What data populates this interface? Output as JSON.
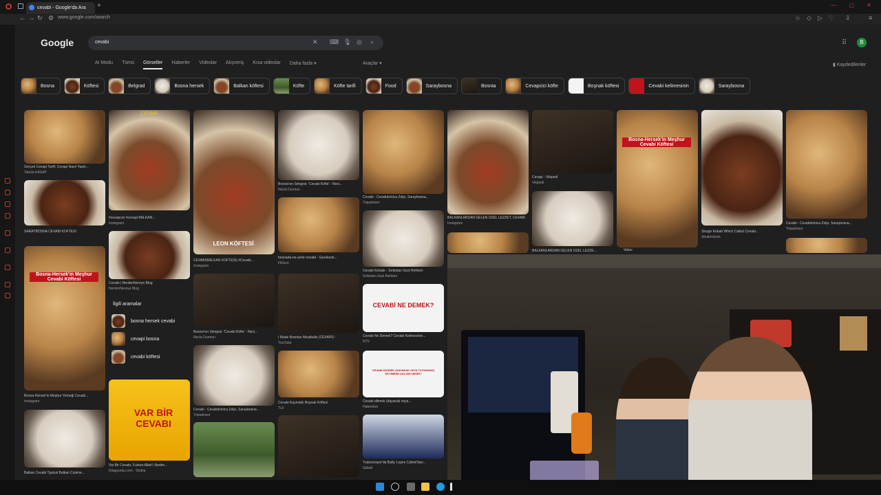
{
  "browser": {
    "tab_title": "cevabi - Google'da Ara",
    "new_tab": "+",
    "url": "www.google.com/search"
  },
  "google": {
    "logo": "Google",
    "query": "cevabi",
    "avatar_letter": "B",
    "nav_tabs": [
      "AI Modu",
      "Tümü",
      "Görseller",
      "Haberler",
      "Videolar",
      "Alışveriş",
      "Kısa videolar",
      "Daha fazla"
    ],
    "active_tab": "Görseller",
    "tools": "Araçlar",
    "saved": "Kaydedilenler"
  },
  "chips": [
    {
      "label": "Bosna"
    },
    {
      "label": "Köftesi"
    },
    {
      "label": "Belgrad"
    },
    {
      "label": "Bosna hersek"
    },
    {
      "label": "Balkan köftesi"
    },
    {
      "label": "Köfte"
    },
    {
      "label": "Köfte tarifi"
    },
    {
      "label": "Food"
    },
    {
      "label": "Saraybosna"
    },
    {
      "label": "Bosnia"
    },
    {
      "label": "Cevapcici köfte"
    },
    {
      "label": "Boşnak köftesi"
    },
    {
      "label": "Cevabi kelimesinin"
    },
    {
      "label": "Saraybosna"
    }
  ],
  "related": {
    "title": "İlgili aramalar",
    "items": [
      "bosna hersek cevabi",
      "cevapi bosna",
      "cevabi köftesi"
    ]
  },
  "results": [
    {
      "caption": "Gerçek Cevapi Tarifi: Cevapi Nasıl Yapılı...",
      "source": "Tabula KASAP"
    },
    {
      "caption": "#cevapcici #cevapi BALKAN...",
      "source": "Instagram"
    },
    {
      "caption": "CEVABİ(BALKAN KÖFTESİ) #Cevabi...",
      "source": "Instagram"
    },
    {
      "caption": "Bosna'nın Simgesi: 'Cevabi Köfte' - Necl...",
      "source": "Necla Durmun"
    },
    {
      "caption": "Cevabi - Cevabdzinica Zeljo, Saraybosna...",
      "source": "Tripadvisor"
    },
    {
      "caption": "BALKANLARDAN GELEN ÖZEL LEZZET, CEVABİ",
      "source": "Instagram"
    },
    {
      "caption": "Ćevapi - Vikipedi",
      "source": "Vikipedi"
    },
    {
      "caption": "Skopje Kebab Which Called Cevabi...",
      "source": "Shutterstock"
    },
    {
      "caption": "Cevabi - Cevabdzinica Zeljo, Saraybosna...",
      "source": "Tripadvisor"
    },
    {
      "caption": "SARAYBOSNA CEVABİ KÖFTESİ",
      "source": ""
    },
    {
      "caption": "Cevabi | NerdenNereye Blog",
      "source": "NerdenNereye Blog"
    },
    {
      "caption": "bosnada-ne-yenir-cevabi - Gezilecek...",
      "source": "FilGezi"
    },
    {
      "caption": "Cevabi Kebabı - Sırbistan Gezi Rehberi",
      "source": "Sırbistan Gezi Rehberi"
    },
    {
      "caption": "BALKANLARDAN GELEN ÖZEL LEZZE...",
      "source": ""
    },
    {
      "caption": "Bosna'nın Simgesi: 'Cevabi Köfte' - Necl...",
      "source": "Necla Durmun"
    },
    {
      "caption": "I Made Bosnian Meatballs (ĆEVAPI)! -",
      "source": "YouTube"
    },
    {
      "caption": "Cevabi Ne Demek? Cevabi Kelimesinin...",
      "source": "NTV"
    },
    {
      "caption": "Bosna-Hersek'in Meşhur Yemeği Cevabi...",
      "source": "Instagram"
    },
    {
      "caption": "Cevabi - Cevabdzinica Zeljo, Saraybosna...",
      "source": "Tripadvisor"
    },
    {
      "caption": "Cevabi Kaymaklı Boşnak Köftesi",
      "source": "Tv2"
    },
    {
      "caption": "Cevabi dilimek (dayanak veya...",
      "source": "Habertürk"
    },
    {
      "caption": "Balkan Cevabi Typical Balkan Cuisine...",
      "source": ""
    },
    {
      "caption": "Var Bir Cevabı, Furkan Allah'ı Neden...",
      "source": "Kitapyurdu.com · Stokta"
    },
    {
      "caption": "Trabzonspor'da Batty Lopes Cabrel'dan...",
      "source": "Sabah"
    }
  ],
  "overlay_text": {
    "bosna1": "Bosna-Hersek'in Meşhur Cevabi Köftesi",
    "bosna2": "Bosna-Hersek'in Meşhur Cevabi Köftesi",
    "cevabi_ne": "CEVABİ NE DEMEK?",
    "var_bir": "VAR BİR CEVABI",
    "deyimin": "CEVABI DİLİMEK (DAYANAK VEYA TUTAKMAK) DEYİMİNİN ANLAMI NEDİR?",
    "video": "Video",
    "cevabi_small": "CEVABİ",
    "leon": "LEON KÖFTESİ"
  },
  "colors": {
    "background": "#1f1f1f",
    "search_box": "#303134",
    "accent_green": "#1e8e3e",
    "tab_red": "#c0392b"
  }
}
